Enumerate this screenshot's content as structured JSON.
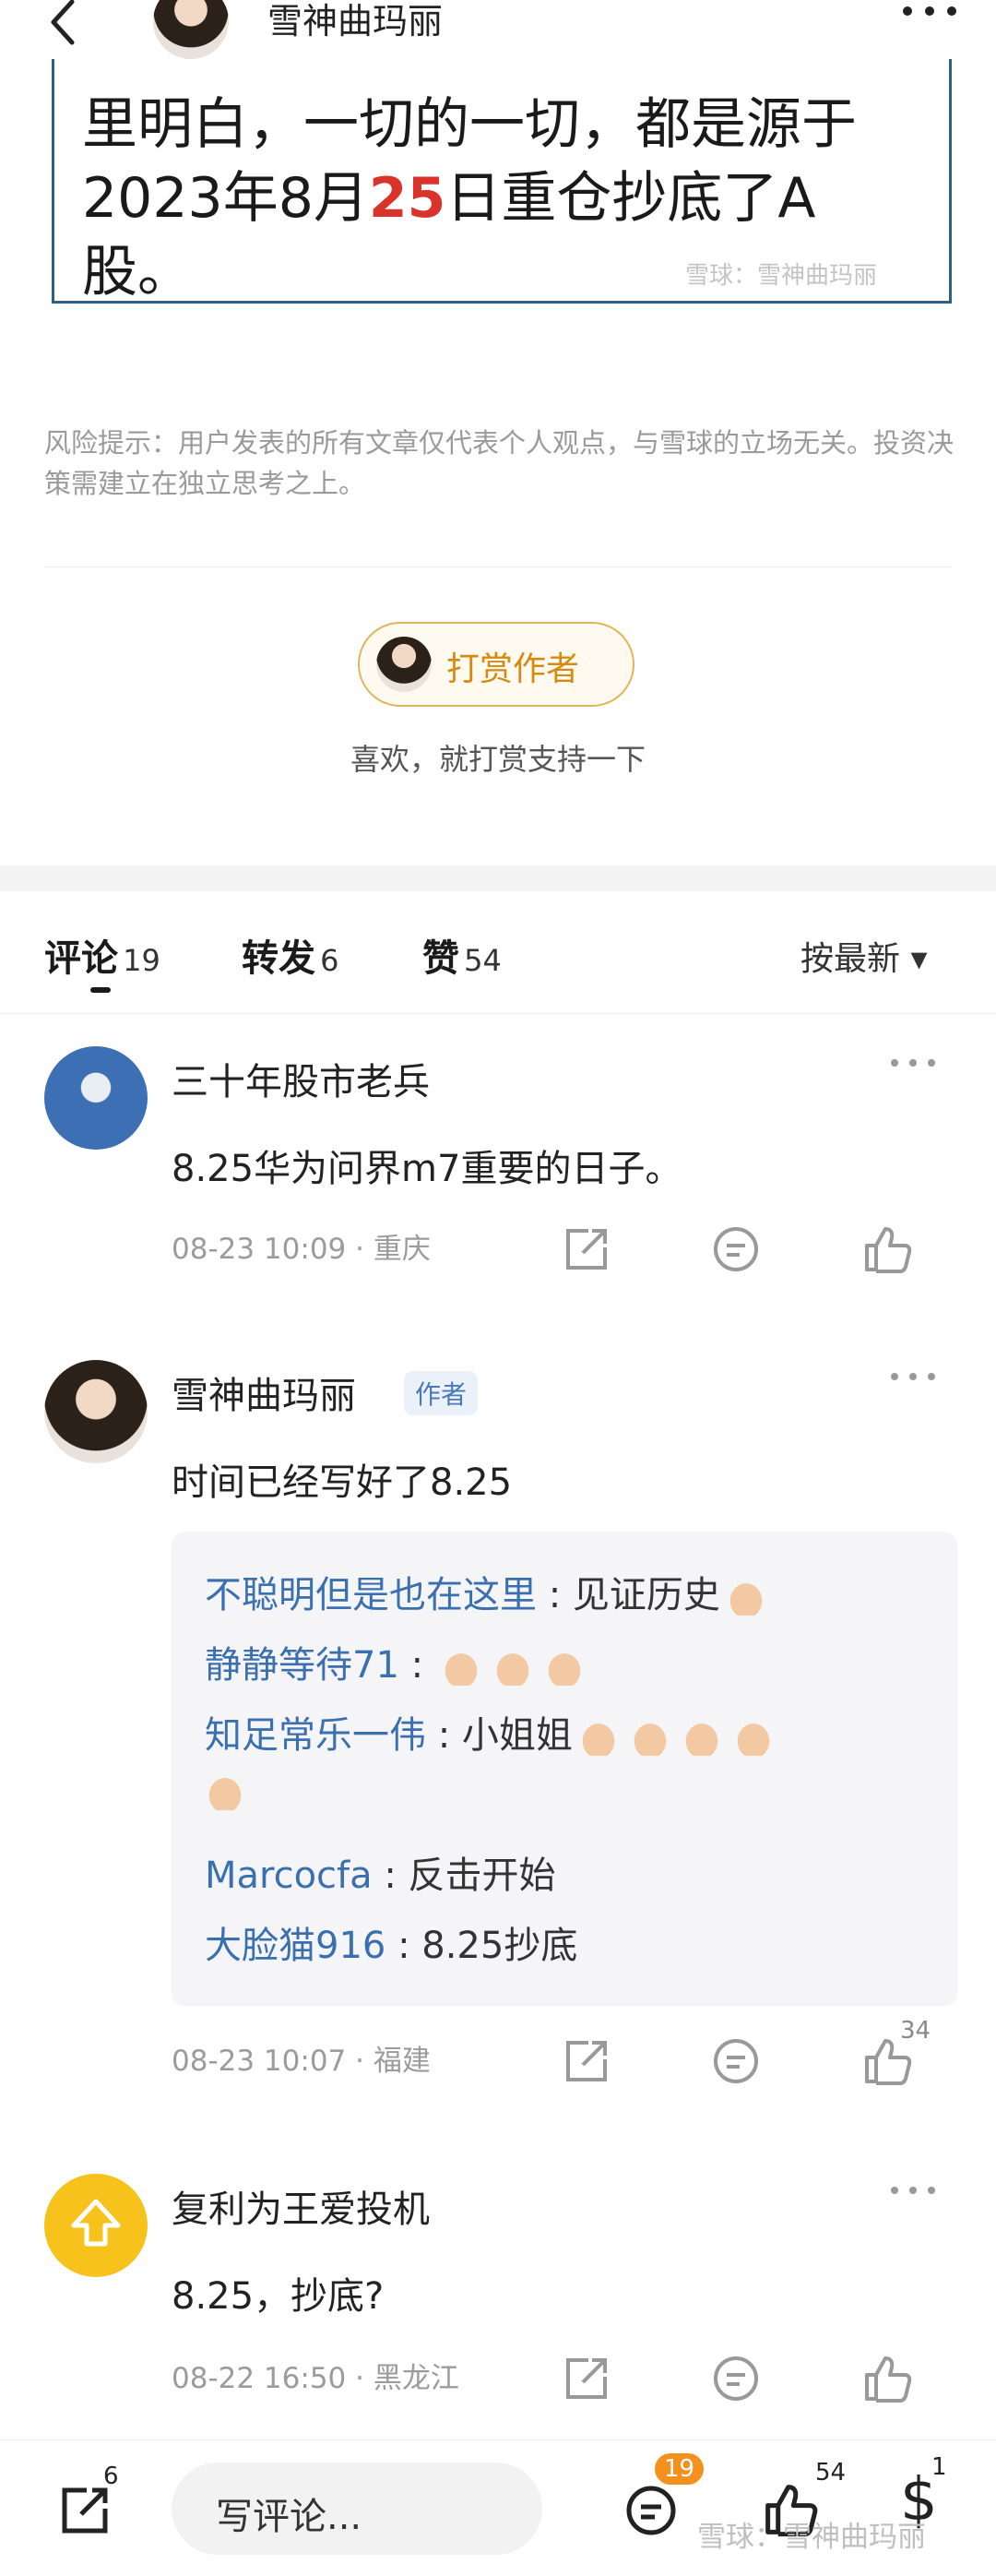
{
  "header": {
    "author_name": "雪神曲玛丽",
    "more_label": "•••",
    "back_label": "<"
  },
  "article": {
    "line1": "里明白，一切的一切，都是源于",
    "line2_pre": "2023年8月",
    "line2_red": "25",
    "line2_post": "日重仓抄底了A",
    "line3": "股。",
    "watermark": "雪球：雪神曲玛丽"
  },
  "risk_notice": "风险提示：用户发表的所有文章仅代表个人观点，与雪球的立场无关。投资决策需建立在独立思考之上。",
  "tip": {
    "button_label": "打赏作者",
    "subtitle": "喜欢，就打赏支持一下"
  },
  "tabs": [
    {
      "label": "评论",
      "count": "19"
    },
    {
      "label": "转发",
      "count": "6"
    },
    {
      "label": "赞",
      "count": "54"
    }
  ],
  "sort_label": "按最新 ▾",
  "comments": [
    {
      "name": "三十年股市老兵",
      "text": "8.25华为问界m7重要的日子。",
      "meta": "08-23 10:09 · 重庆"
    },
    {
      "name": "雪神曲玛丽",
      "badge": "作者",
      "text": "时间已经写好了8.25",
      "replies": [
        {
          "user": "不聪明但是也在这里",
          "sep": " : ",
          "text": "见证历史"
        },
        {
          "user": "静静等待71",
          "sep": " : ",
          "text": ""
        },
        {
          "user": "知足常乐一伟",
          "sep": " : ",
          "text": "小姐姐"
        },
        {
          "user": "Marcocfa",
          "sep": " : ",
          "text": "反击开始"
        },
        {
          "user": "大脸猫916",
          "sep": " : ",
          "text": "8.25抄底"
        }
      ],
      "meta": "08-23 10:07 · 福建",
      "like_count": "34"
    },
    {
      "name": "复利为王爱投机",
      "text": "8.25，抄底?",
      "meta": "08-22 16:50 · 黑龙江"
    }
  ],
  "bottom_bar": {
    "repost_count": "6",
    "comment_placeholder": "写评论...",
    "comment_count": "19",
    "like_count": "54",
    "reward_count": "1",
    "watermark": "雪球：雪神曲玛丽"
  }
}
